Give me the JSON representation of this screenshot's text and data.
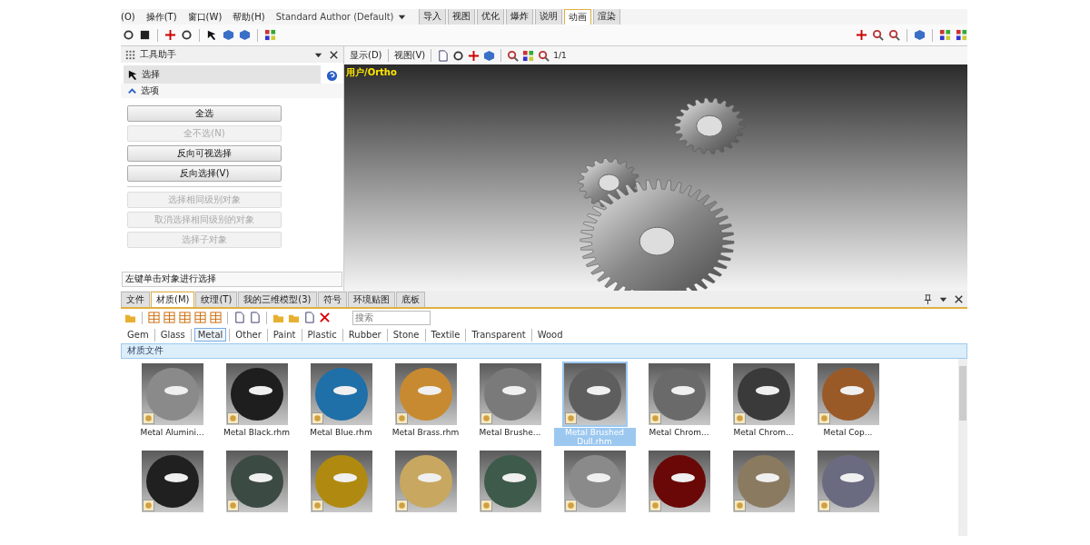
{
  "menu": {
    "items": [
      "(O)",
      "操作(T)",
      "窗口(W)",
      "帮助(H)"
    ],
    "workspace": "Standard Author (Default)",
    "ribbon_tabs": [
      {
        "label": "导入",
        "selected": false
      },
      {
        "label": "视图",
        "selected": false
      },
      {
        "label": "优化",
        "selected": false
      },
      {
        "label": "爆炸",
        "selected": false
      },
      {
        "label": "说明",
        "selected": false
      },
      {
        "label": "动画",
        "selected": true
      },
      {
        "label": "渲染",
        "selected": false
      }
    ]
  },
  "tool_helper": {
    "title": "工具助手",
    "tool": "选择",
    "section": "选项",
    "expanded": true,
    "buttons": [
      {
        "label": "全选",
        "disabled": false
      },
      {
        "label": "全不选(N)",
        "disabled": true
      },
      {
        "label": "反向可视选择",
        "disabled": false
      },
      {
        "label": "反向选择(V)",
        "disabled": false
      },
      {
        "label": "选择相同级别对象",
        "disabled": true
      },
      {
        "label": "取消选择相同级别的对象",
        "disabled": true
      },
      {
        "label": "选择子对象",
        "disabled": true
      }
    ],
    "status": "左键单击对象进行选择"
  },
  "viewport": {
    "menus": [
      "显示(D)",
      "视图(V)"
    ],
    "zoom_label": "1/1",
    "label": "用户/Ortho"
  },
  "library": {
    "tabs": [
      {
        "label": "文件",
        "selected": false
      },
      {
        "label": "材质(M)",
        "selected": true
      },
      {
        "label": "纹理(T)",
        "selected": false
      },
      {
        "label": "我的三维模型(3)",
        "selected": false
      },
      {
        "label": "符号",
        "selected": false
      },
      {
        "label": "环境贴图",
        "selected": false
      },
      {
        "label": "底板",
        "selected": false
      }
    ],
    "search": {
      "placeholder": "搜索"
    },
    "categories": [
      {
        "label": "Gem",
        "selected": false
      },
      {
        "label": "Glass",
        "selected": false
      },
      {
        "label": "Metal",
        "selected": true
      },
      {
        "label": "Other",
        "selected": false
      },
      {
        "label": "Paint",
        "selected": false
      },
      {
        "label": "Plastic",
        "selected": false
      },
      {
        "label": "Rubber",
        "selected": false
      },
      {
        "label": "Stone",
        "selected": false
      },
      {
        "label": "Textile",
        "selected": false
      },
      {
        "label": "Transparent",
        "selected": false
      },
      {
        "label": "Wood",
        "selected": false
      }
    ],
    "folder": "材质文件",
    "materials": [
      {
        "name": "Metal Alumini...",
        "color": "#8a8a8a",
        "selected": false
      },
      {
        "name": "Metal Black.rhm",
        "color": "#1e1e1e",
        "selected": false
      },
      {
        "name": "Metal Blue.rhm",
        "color": "#1f6fa8",
        "selected": false
      },
      {
        "name": "Metal Brass.rhm",
        "color": "#c88a30",
        "selected": false
      },
      {
        "name": "Metal Brushe...",
        "color": "#7a7a7a",
        "selected": false
      },
      {
        "name": "Metal Brushed Dull.rhm",
        "color": "#5e5e5e",
        "selected": true
      },
      {
        "name": "Metal Chrom...",
        "color": "#6a6a6a",
        "selected": false
      },
      {
        "name": "Metal Chrom...",
        "color": "#3a3a3a",
        "selected": false
      },
      {
        "name": "Metal Cop...",
        "color": "#9a5a28",
        "selected": false
      },
      {
        "color": "#202020",
        "selected": false
      },
      {
        "color": "#3c4a44",
        "selected": false
      },
      {
        "color": "#b08a10",
        "selected": false
      },
      {
        "color": "#c8a860",
        "selected": false
      },
      {
        "color": "#3e5a4a",
        "selected": false
      },
      {
        "color": "#8a8a8a",
        "selected": false
      },
      {
        "color": "#6a0808",
        "selected": false
      },
      {
        "color": "#8a7a60",
        "selected": false
      },
      {
        "color": "#6a6a80",
        "selected": false
      }
    ]
  }
}
